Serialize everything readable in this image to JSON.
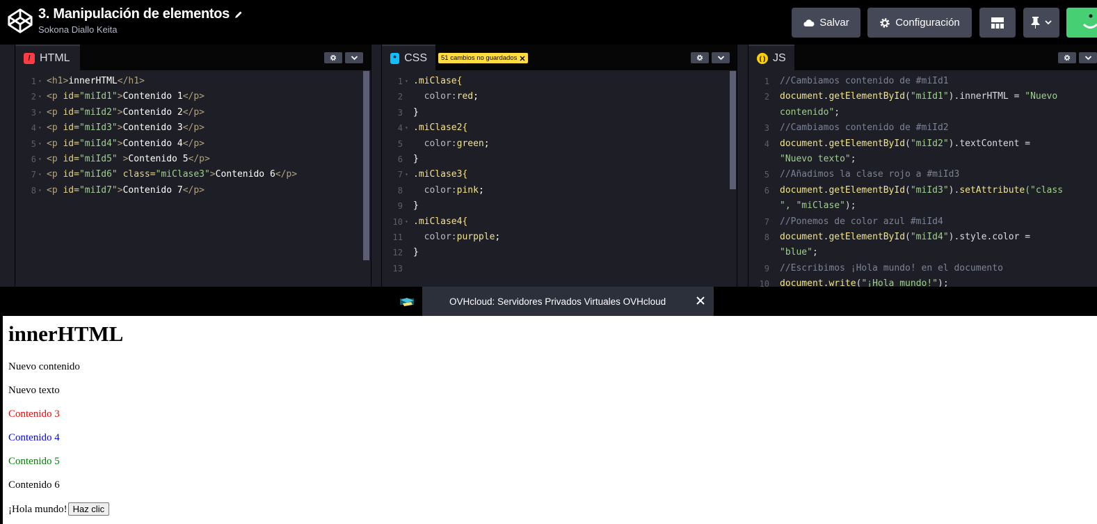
{
  "header": {
    "pen_title": "3. Manipulación de elementos",
    "author": "Sokona Diallo Keita",
    "save_label": "Salvar",
    "settings_label": "Configuración"
  },
  "editors": {
    "html": {
      "label": "HTML",
      "icon_color": "#ff3c41",
      "lines": [
        "1",
        "2",
        "3",
        "4",
        "5",
        "6",
        "7",
        "8"
      ]
    },
    "css": {
      "label": "CSS",
      "icon_color": "#0ebeff",
      "unsaved_badge": "51 cambios no guardados",
      "lines": [
        "1",
        "2",
        "3",
        "4",
        "5",
        "6",
        "7",
        "8",
        "9",
        "10",
        "11",
        "12",
        "13"
      ]
    },
    "js": {
      "label": "JS",
      "icon_color": "#fcd000",
      "lines": [
        "1",
        "2",
        "",
        "3",
        "4",
        "",
        "5",
        "6",
        "",
        "7",
        "8",
        "",
        "9",
        "10"
      ]
    }
  },
  "html_code": {
    "l1": {
      "open": "<h1>",
      "text": "innerHTML",
      "close": "</h1>"
    },
    "l2": {
      "open": "<p",
      "attr": " id=",
      "val": "\"miId1\"",
      "end": ">",
      "text": "Contenido 1",
      "close": "</p>"
    },
    "l3": {
      "open": "<p",
      "attr": " id=",
      "val": "\"miId2\"",
      "end": ">",
      "text": "Contenido 2",
      "close": "</p>"
    },
    "l4": {
      "open": "<p",
      "attr": " id=",
      "val": "\"miId3\"",
      "end": ">",
      "text": "Contenido 3",
      "close": "</p>"
    },
    "l5": {
      "open": "<p",
      "attr": " id=",
      "val": "\"miId4\"",
      "end": ">",
      "text": "Contenido 4",
      "close": "</p>"
    },
    "l6": {
      "open": "<p",
      "attr": " id=",
      "val": "\"miId5\"",
      "end": " >",
      "text": "Contenido 5",
      "close": "</p>"
    },
    "l7": {
      "open": "<p",
      "attr": " id=",
      "val": "\"miId6\"",
      "attr2": " class=",
      "val2": "\"miClase3\"",
      "end": ">",
      "text": "Contenido 6",
      "close": "</p>"
    },
    "l8": {
      "open": "<p",
      "attr": " id=",
      "val": "\"miId7\"",
      "end": ">",
      "text": "Contenido 7",
      "close": "</p>"
    }
  },
  "css_code": {
    "l1": ".miClase{",
    "l2_prop": "color:",
    "l2_val": "red",
    "l2_end": ";",
    "l3": "}",
    "l4": ".miClase2{",
    "l5_prop": "color:",
    "l5_val": "green",
    "l5_end": ";",
    "l6": "}",
    "l7": ".miClase3{",
    "l8_prop": "color:",
    "l8_val": "pink",
    "l8_end": ";",
    "l9": "}",
    "l10": ".miClase4{",
    "l11_prop": "color:",
    "l11_val": "purpple",
    "l11_end": ";",
    "l12": "}"
  },
  "js_code": {
    "c1": "//Cambiamos contenido de #miId1",
    "l2a": "document",
    "l2b": ".",
    "l2c": "getElementById",
    "l2d": "(",
    "l2e": "\"miId1\"",
    "l2f": ").",
    "l2g": "innerHTML",
    "l2h": " = ",
    "l2i": "\"Nuevo",
    "l2cont": "contenido\"",
    "l2cont_end": ";",
    "c3": "//Cambiamos contenido de #miId2",
    "l4a": "document",
    "l4c": "getElementById",
    "l4e": "\"miId2\"",
    "l4g": "textContent",
    "l4h": " =",
    "l4cont": "\"Nuevo texto\"",
    "l4cont_end": ";",
    "c5": "//Añadimos la clase rojo a #miId3",
    "l6a": "document",
    "l6c": "getElementById",
    "l6e": "\"miId3\"",
    "l6g": "setAttribute",
    "l6i": "(\"class",
    "l6cont": "\", \"miClase\"",
    "l6cont_end": ");",
    "c7": "//Ponemos de color azul #miId4",
    "l8a": "document",
    "l8c": "getElementById",
    "l8e": "\"miId4\"",
    "l8g": "style",
    "l8g2": "color",
    "l8h": " =",
    "l8cont": "\"blue\"",
    "l8cont_end": ";",
    "c9": "//Escribimos ¡Hola mundo! en el documento",
    "l10a": "document",
    "l10c": "write",
    "l10e": "\"¡Hola mundo!\"",
    "l10end": ");"
  },
  "ad": {
    "text": "OVHcloud: Servidores Privados Virtuales OVHcloud"
  },
  "preview": {
    "heading": "innerHTML",
    "p1": "Nuevo contenido",
    "p2": "Nuevo texto",
    "p3": "Contenido 3",
    "p4": "Contenido 4",
    "p5": "Contenido 5",
    "p6": "Contenido 6",
    "p7": "¡Hola mundo!",
    "button": "Haz clic",
    "colors": {
      "p3": "#ff0000",
      "p4": "#0000ff",
      "p5": "#008000"
    }
  }
}
